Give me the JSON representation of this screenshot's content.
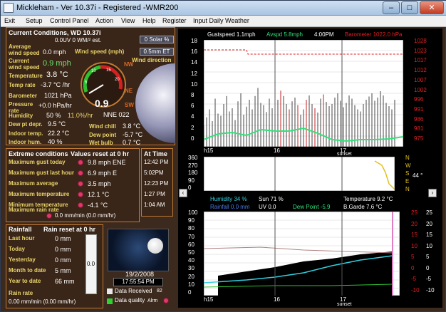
{
  "title": "Mickleham - Ver 10.37i - Registered  -WMR200",
  "menu": [
    "Exit",
    "Setup",
    "Control Panel",
    "Action",
    "View",
    "Help",
    "Register",
    "Input Daily Weather"
  ],
  "current": {
    "header": "Current Conditions, WD 10.37i",
    "solar_line": "0.0UV  0 WM/² est.",
    "solar_btn": "0 Solar %",
    "et_btn": "0.5mm ET",
    "avg_wind_label": "Average wind speed",
    "avg_wind_value": "0.0 mph",
    "wind_speed_label": "Wind speed (mph)",
    "cur_wind_label": "Current wind speed",
    "cur_wind_value": "0.9 mph",
    "wind_dir_label": "Wind direction",
    "temp_label": "Temperature",
    "temp_value": "3.8 °C",
    "temprate_label": "Temp rate",
    "temprate_value": "-3.7 °C /hr",
    "baro_label": "Barometer",
    "baro_value": "1021 hPa",
    "pressrate_label": "Pressure rate",
    "pressrate_value": "+0.0 hPa/hr",
    "humidity_label": "Humidity",
    "humidity_value": "50 %",
    "humrate_value": "11.0%/hr",
    "dewdepr_label": "Dew pt depr.",
    "dewdepr_value": "9.5 °C",
    "indoortemp_label": "Indoor temp.",
    "indoortemp_value": "22.2 °C",
    "indoorhum_label": "Indoor hum.",
    "indoorhum_value": "40 %",
    "gauge_value": "0.9",
    "gauge_ticks": [
      "5",
      "10",
      "15",
      "20"
    ],
    "wind_dir_text": "NNE 022",
    "windchill_label": "Wind chill",
    "windchill_value": "3.8 °C",
    "dewpoint_label": "Dew point",
    "dewpoint_value": "-5.7 °C",
    "wetbulb_label": "Wet bulb",
    "wetbulb_value": "0.7 °C",
    "compass": [
      "NW",
      "NE",
      "SW"
    ]
  },
  "extremes": {
    "header": "Extreme conditions",
    "reset": "Values reset at 0 hr",
    "at_time": "At Time",
    "rows": [
      {
        "label": "Maximum gust today",
        "value": "9.8 mph ENE",
        "time": "12:42 PM"
      },
      {
        "label": "Maximum gust last hour",
        "value": "6.9 mph   E",
        "time": "5:02PM"
      },
      {
        "label": "Maximum average",
        "value": "3.5 mph",
        "time": "12:23 PM"
      },
      {
        "label": "Maximum temperature",
        "value": "12.1 °C",
        "time": "1:27 PM"
      },
      {
        "label": "Minimum temperature",
        "value": "-4.1 °C",
        "time": "1:04 AM"
      },
      {
        "label": "Maximum rain rate",
        "value": "0.0 mm/min (0.0 mm/hr)",
        "time": ""
      }
    ]
  },
  "rainfall": {
    "header": "Rainfall",
    "reset": "Rain reset at 0 hr",
    "rows": [
      {
        "label": "Last hour",
        "value": "0 mm"
      },
      {
        "label": "Today",
        "value": "0 mm"
      },
      {
        "label": "Yesterday",
        "value": "0 mm"
      },
      {
        "label": "Month to date",
        "value": "5 mm"
      },
      {
        "label": "Year to date",
        "value": "66 mm"
      }
    ],
    "rate_label": "Rain rate",
    "rate_value": "0.00 mm/min (0.00 mm/hr)",
    "tube_value": "0.0"
  },
  "moon": {
    "date": "19/2/2008",
    "time": "17:55:54 PM"
  },
  "status": {
    "received": "Data Received",
    "received_count": "82",
    "quality": "Data quality",
    "alarm": "Alrm"
  },
  "graph_top": {
    "gust_label": "Gustspeed  1.1mph",
    "avspd_label": "Avspd  5.8mph",
    "time_label": "4:00PM",
    "baro_label": "Barometer 1022.0 hPa",
    "left_ticks": [
      "18",
      "16",
      "14",
      "12",
      "10",
      "8",
      "6",
      "4",
      "2",
      "0"
    ],
    "right_ticks": [
      "1028",
      "1023",
      "1017",
      "1012",
      "1007",
      "1002",
      "996",
      "991",
      "986",
      "981",
      "975"
    ],
    "x_labels": [
      "h15",
      "16",
      "17",
      "sunset"
    ]
  },
  "graph_dir": {
    "ticks": [
      "360",
      "270",
      "180",
      "90",
      "0"
    ],
    "compass": [
      "N",
      "W",
      "S",
      "E",
      "N"
    ],
    "current": "44 °"
  },
  "graph_bottom": {
    "humidity": "Humidity   34 %",
    "sun": "Sun   71 %",
    "temperature": "Temperature        9.2 °C",
    "rainfall": "Rainfall    0.0 mm",
    "uv": "UV   0.0",
    "dewpoint": "Dew Point   -5.9",
    "bgarde": "B.Garde        7.6 °C",
    "left_ticks": [
      "100",
      "90",
      "80",
      "70",
      "60",
      "50",
      "40",
      "30",
      "20",
      "10",
      "0"
    ],
    "right_a": [
      "25",
      "20",
      "15",
      "10",
      "5",
      "0",
      "-5",
      "-10"
    ],
    "right_b": [
      "25",
      "20",
      "15",
      "10",
      "5",
      "0",
      "-5",
      "-10"
    ],
    "x_labels": [
      "h15",
      "16",
      "17",
      "sunset"
    ]
  },
  "colors": {
    "accent": "#c07a35",
    "gold": "#e8d46a",
    "pink": "#e0376a",
    "green": "#33e07a",
    "red": "#e02020",
    "cyan": "#30d0e0"
  }
}
